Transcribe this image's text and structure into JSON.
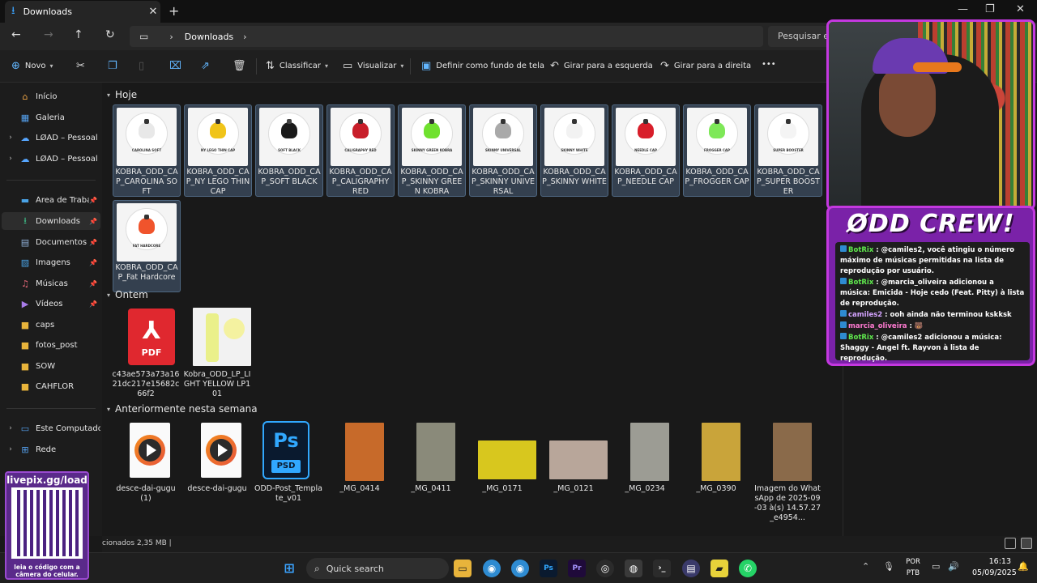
{
  "tab": {
    "title": "Downloads",
    "icon": "download-icon"
  },
  "address": {
    "crumb": "Downloads",
    "search_placeholder": "Pesquisar em"
  },
  "toolbar": {
    "new_label": "Novo",
    "sort_label": "Classificar",
    "view_label": "Visualizar",
    "set_bg_label": "Definir como fundo de tela",
    "rotate_left_label": "Girar para a esquerda",
    "rotate_right_label": "Girar para a direita",
    "more_label": "•••"
  },
  "sidebar": {
    "items": [
      {
        "label": "Início",
        "icon": "home-icon"
      },
      {
        "label": "Galeria",
        "icon": "gallery-icon"
      },
      {
        "label": "LØAD – Pessoal",
        "icon": "cloud-icon"
      },
      {
        "label": "LØAD – Pessoal",
        "icon": "cloud-icon"
      },
      {
        "label": "Área de Trabalho",
        "icon": "desktop-icon"
      },
      {
        "label": "Downloads",
        "icon": "download-icon"
      },
      {
        "label": "Documentos",
        "icon": "documents-icon"
      },
      {
        "label": "Imagens",
        "icon": "pictures-icon"
      },
      {
        "label": "Músicas",
        "icon": "music-icon"
      },
      {
        "label": "Vídeos",
        "icon": "videos-icon"
      },
      {
        "label": "caps",
        "icon": "folder-icon"
      },
      {
        "label": "fotos_post",
        "icon": "folder-icon"
      },
      {
        "label": "SOW",
        "icon": "folder-icon"
      },
      {
        "label": "CAHFLOR",
        "icon": "folder-icon"
      },
      {
        "label": "Este Computador",
        "icon": "computer-icon"
      },
      {
        "label": "Rede",
        "icon": "network-icon"
      }
    ]
  },
  "groups": {
    "today": "Hoje",
    "yesterday": "Ontem",
    "earlier": "Anteriormente nesta semana"
  },
  "today_files": [
    {
      "name": "KOBRA_ODD_CAP_CAROLINA SOFT",
      "cap_label": "CAROLINA SOFT",
      "color": "#e8e8e8"
    },
    {
      "name": "KOBRA_ODD_CAP_NY LEGO THIN CAP",
      "cap_label": "NY LEGO THIN CAP",
      "color": "#f0c419"
    },
    {
      "name": "KOBRA_ODD_CAP_SOFT BLACK",
      "cap_label": "SOFT BLACK",
      "color": "#1a1a1a"
    },
    {
      "name": "KOBRA_ODD_CAP_CALIGRAPHY RED",
      "cap_label": "CALIGRAPHY RED",
      "color": "#c81e2a"
    },
    {
      "name": "KOBRA_ODD_CAP_SKINNY GREEN KOBRA",
      "cap_label": "SKINNY GREEN KOBRA",
      "color": "#6fe12e"
    },
    {
      "name": "KOBRA_ODD_CAP_SKINNY UNIVERSAL",
      "cap_label": "SKINNY UNIVERSAL",
      "color": "#a9a9a9"
    },
    {
      "name": "KOBRA_ODD_CAP_SKINNY WHITE",
      "cap_label": "SKINNY WHITE",
      "color": "#f2f2f2"
    },
    {
      "name": "KOBRA_ODD_CAP_NEEDLE CAP",
      "cap_label": "NEEDLE CAP",
      "color": "#d81e2a"
    },
    {
      "name": "KOBRA_ODD_CAP_FROGGER CAP",
      "cap_label": "FROGGER CAP",
      "color": "#7ee858"
    },
    {
      "name": "KOBRA_ODD_CAP_SUPER BOOSTER",
      "cap_label": "SUPER BOOSTER",
      "color": "#f4f4f4"
    },
    {
      "name": "KOBRA_ODD_CAP_Fat Hardcore",
      "cap_label": "FAT HARDCORE",
      "color": "#f0542c"
    }
  ],
  "yesterday_files": [
    {
      "name": "c43ae573a73a1621dc217e15682c66f2",
      "type": "pdf",
      "icon_text": "PDF"
    },
    {
      "name": "Kobra_ODD_LP_LIGHT YELLOW LP101",
      "type": "image"
    }
  ],
  "earlier_files": [
    {
      "name": "desce-dai-gugu (1)",
      "type": "video"
    },
    {
      "name": "desce-dai-gugu",
      "type": "video"
    },
    {
      "name": "ODD-Post_Template_v01",
      "type": "psd",
      "icon_ps": "Ps",
      "icon_psd": "PSD"
    },
    {
      "name": "_MG_0414",
      "type": "photo",
      "color": "#c76a2a"
    },
    {
      "name": "_MG_0411",
      "type": "photo",
      "color": "#8a8a7a"
    },
    {
      "name": "_MG_0171",
      "type": "photo",
      "color": "#d8c71e"
    },
    {
      "name": "_MG_0121",
      "type": "photo",
      "color": "#b8a69a"
    },
    {
      "name": "_MG_0234",
      "type": "photo",
      "color": "#9c9c94"
    },
    {
      "name": "_MG_0390",
      "type": "photo",
      "color": "#c9a43a"
    },
    {
      "name": "Imagem do WhatsApp de 2025-09-03 à(s) 14.57.27_e4954...",
      "type": "photo",
      "color": "#8a6a4a"
    }
  ],
  "status": {
    "text": "cionados  2,35 MB  |"
  },
  "taskbar": {
    "search_label": "Quick search",
    "lang_top": "POR",
    "lang_bottom": "PTB",
    "time": "16:13",
    "date": "05/09/2025"
  },
  "overlay": {
    "logo": "ØDD CREW!",
    "qr_title": "livepix.gg/load",
    "qr_caption": "leia o código com a câmera do celular.",
    "chat": [
      {
        "user": "BotRix",
        "text": " : @camiles2, você atingiu o número máximo de músicas permitidas na lista de reprodução por usuário.",
        "kind": "bot"
      },
      {
        "user": "BotRix",
        "text": " : @marcia_oliveira adicionou a música: Emicida - Hoje cedo (Feat. Pitty) à lista de reprodução.",
        "kind": "bot"
      },
      {
        "user": "camiles2",
        "text": " : ooh ainda não terminou kskksk",
        "kind": "user"
      },
      {
        "user": "marcia_oliveira",
        "text": " : 🐻",
        "kind": "user2"
      },
      {
        "user": "BotRix",
        "text": " : @camiles2 adicionou a música: Shaggy - Angel ft. Rayvon à lista de reprodução.",
        "kind": "bot"
      }
    ]
  }
}
